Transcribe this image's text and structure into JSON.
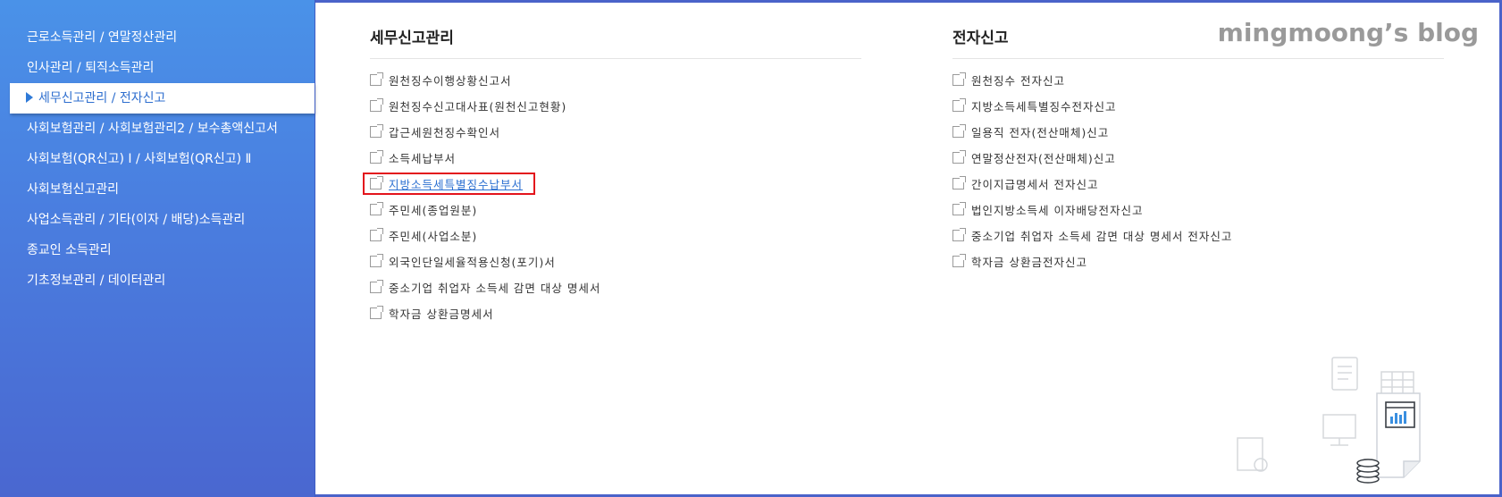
{
  "sidebar": {
    "items": [
      {
        "label": "근로소득관리 / 연말정산관리"
      },
      {
        "label": "인사관리 / 퇴직소득관리"
      },
      {
        "label": "세무신고관리 / 전자신고"
      },
      {
        "label": "사회보험관리 / 사회보험관리2 / 보수총액신고서"
      },
      {
        "label": "사회보험(QR신고) Ⅰ / 사회보험(QR신고) Ⅱ"
      },
      {
        "label": "사회보험신고관리"
      },
      {
        "label": "사업소득관리 / 기타(이자 / 배당)소득관리"
      },
      {
        "label": "종교인 소득관리"
      },
      {
        "label": "기초정보관리 / 데이터관리"
      }
    ],
    "active_index": 2
  },
  "tax": {
    "title": "세무신고관리",
    "items": [
      {
        "label": "원천징수이행상황신고서"
      },
      {
        "label": "원천징수신고대사표(원천신고현황)"
      },
      {
        "label": "갑근세원천징수확인서"
      },
      {
        "label": "소득세납부서"
      },
      {
        "label": "지방소득세특별징수납부서"
      },
      {
        "label": "주민세(종업원분)"
      },
      {
        "label": "주민세(사업소분)"
      },
      {
        "label": "외국인단일세율적용신청(포기)서"
      },
      {
        "label": "중소기업 취업자 소득세 감면 대상 명세서"
      },
      {
        "label": "학자금 상환금명세서"
      }
    ]
  },
  "efile": {
    "title": "전자신고",
    "items": [
      {
        "label": "원천징수 전자신고"
      },
      {
        "label": "지방소득세특별징수전자신고"
      },
      {
        "label": "일용직 전자(전산매체)신고"
      },
      {
        "label": "연말정산전자(전산매체)신고"
      },
      {
        "label": "간이지급명세서 전자신고"
      },
      {
        "label": "법인지방소득세 이자배당전자신고"
      },
      {
        "label": "중소기업 취업자 소득세 감면 대상 명세서 전자신고"
      },
      {
        "label": "학자금 상환금전자신고"
      }
    ]
  },
  "watermark": "mingmoong’s blog",
  "colors": {
    "accent": "#4a7fe0",
    "highlight_border": "#e3141c",
    "link": "#2b6fd1"
  }
}
